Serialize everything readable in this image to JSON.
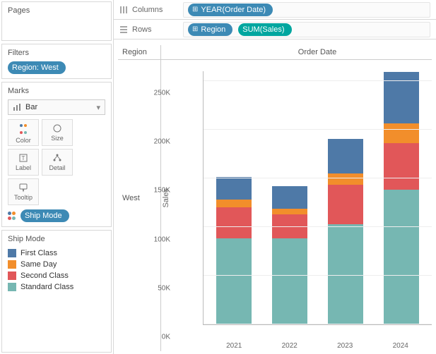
{
  "sidebar": {
    "pages_title": "Pages",
    "filters_title": "Filters",
    "filter_pill": "Region: West",
    "marks_title": "Marks",
    "marks_type": "Bar",
    "mark_buttons": {
      "color": "Color",
      "size": "Size",
      "label": "Label",
      "detail": "Detail",
      "tooltip": "Tooltip"
    },
    "color_encoding_pill": "Ship Mode",
    "legend_title": "Ship Mode",
    "legend_items": [
      {
        "label": "First Class",
        "color": "#4e79a7"
      },
      {
        "label": "Same Day",
        "color": "#f28e2b"
      },
      {
        "label": "Second Class",
        "color": "#e15759"
      },
      {
        "label": "Standard Class",
        "color": "#76b7b2"
      }
    ]
  },
  "shelves": {
    "columns_label": "Columns",
    "rows_label": "Rows",
    "columns_pills": {
      "year": "YEAR(Order Date)"
    },
    "rows_pills": {
      "region": "Region",
      "sum_sales": "SUM(Sales)"
    }
  },
  "viz": {
    "col_header_field": "Region",
    "col_header_title": "Order Date",
    "row_header_value": "West",
    "y_axis_label": "Sales",
    "x_categories": [
      "2021",
      "2022",
      "2023",
      "2024"
    ],
    "y_ticks": [
      "0K",
      "50K",
      "100K",
      "150K",
      "200K",
      "250K"
    ]
  },
  "chart_data": {
    "type": "bar",
    "stacked": true,
    "title": "",
    "xlabel": "Order Date",
    "ylabel": "Sales",
    "ylim": [
      0,
      260000
    ],
    "categories": [
      "2021",
      "2022",
      "2023",
      "2024"
    ],
    "stack_order_bottom_to_top": [
      "Standard Class",
      "Second Class",
      "Same Day",
      "First Class"
    ],
    "series": [
      {
        "name": "First Class",
        "color": "#4e79a7",
        "values": [
          23000,
          23000,
          35000,
          53000
        ]
      },
      {
        "name": "Same Day",
        "color": "#f28e2b",
        "values": [
          8000,
          6000,
          12000,
          20000
        ]
      },
      {
        "name": "Second Class",
        "color": "#e15759",
        "values": [
          32000,
          25000,
          40000,
          48000
        ]
      },
      {
        "name": "Standard Class",
        "color": "#76b7b2",
        "values": [
          88000,
          88000,
          103000,
          138000
        ]
      }
    ],
    "totals": [
      151000,
      142000,
      190000,
      259000
    ],
    "region_filter": "West"
  }
}
